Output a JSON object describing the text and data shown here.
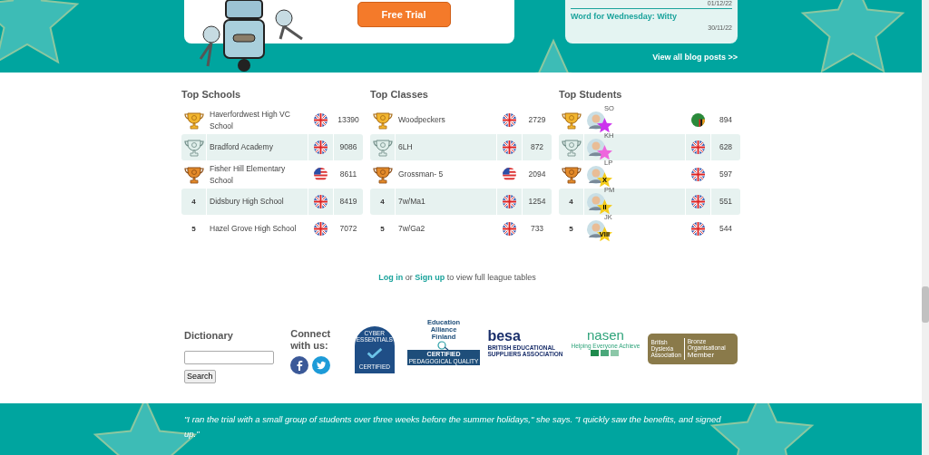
{
  "hero": {
    "button": "Free Trial",
    "blog": {
      "date_top": "01/12/22",
      "post_title": "Word for Wednesday: Witty",
      "post_date": "30/11/22"
    },
    "view_all": "View all blog posts >>"
  },
  "leagues": [
    {
      "title": "Top Schools",
      "rows": [
        {
          "kind": "gold",
          "name": "Haverfordwest High VC School",
          "flag": {
            "kind": "uk"
          },
          "score": "13390",
          "shaded": false
        },
        {
          "kind": "silver",
          "name": "Bradford Academy",
          "flag": {
            "kind": "uk"
          },
          "score": "9086",
          "shaded": true
        },
        {
          "kind": "bronze",
          "name": "Fisher Hill Elementary School",
          "flag": {
            "kind": "us"
          },
          "score": "8611",
          "shaded": false
        },
        {
          "rank": "4",
          "kind": "number",
          "name": "Didsbury High School",
          "flag": {
            "kind": "uk"
          },
          "score": "8419",
          "shaded": true
        },
        {
          "rank": "5",
          "kind": "number",
          "name": "Hazel Grove High School",
          "flag": {
            "kind": "uk"
          },
          "score": "7072",
          "shaded": false
        }
      ]
    },
    {
      "title": "Top Classes",
      "rows": [
        {
          "kind": "gold",
          "name": "Woodpeckers",
          "flag": {
            "kind": "uk"
          },
          "score": "2729",
          "shaded": false
        },
        {
          "kind": "silver",
          "name": "6LH",
          "flag": {
            "kind": "uk"
          },
          "score": "872",
          "shaded": true
        },
        {
          "kind": "bronze",
          "name": "Grossman- 5",
          "flag": {
            "kind": "us"
          },
          "score": "2094",
          "shaded": false
        },
        {
          "rank": "4",
          "kind": "number",
          "name": "7w/Ma1",
          "flag": {
            "kind": "uk"
          },
          "score": "1254",
          "shaded": true
        },
        {
          "rank": "5",
          "kind": "number",
          "name": "7w/Ga2",
          "flag": {
            "kind": "uk"
          },
          "score": "733",
          "shaded": false
        }
      ]
    },
    {
      "title": "Top Students",
      "rows": [
        {
          "kind": "gold",
          "initials": "SO",
          "badge": {
            "color": "#cc33ee"
          },
          "flag": {
            "kind": "zm"
          },
          "score": "894",
          "shaded": false
        },
        {
          "kind": "silver",
          "initials": "KH",
          "badge": {
            "color": "#ee66dd"
          },
          "flag": {
            "kind": "uk"
          },
          "score": "628",
          "shaded": true
        },
        {
          "kind": "bronze",
          "initials": "LP",
          "badge": {
            "color": "#f5cc1a",
            "label": "X"
          },
          "flag": {
            "kind": "uk"
          },
          "score": "597",
          "shaded": false
        },
        {
          "rank": "4",
          "kind": "number",
          "initials": "PM",
          "badge": {
            "color": "#f5cc1a",
            "label": "II"
          },
          "flag": {
            "kind": "uk"
          },
          "score": "551",
          "shaded": true
        },
        {
          "rank": "5",
          "kind": "number",
          "initials": "JK",
          "badge": {
            "color": "#f5cc1a",
            "label": "VIII"
          },
          "flag": {
            "kind": "uk"
          },
          "score": "544",
          "shaded": false
        }
      ]
    }
  ],
  "login_line": {
    "login": "Log in",
    "or": "or",
    "signup": "Sign up",
    "rest": "to view full league tables"
  },
  "dictionary": {
    "title": "Dictionary",
    "button": "Search"
  },
  "connect": {
    "title": "Connect with us:"
  },
  "logos": {
    "cyber": [
      "CYBER ESSENTIALS",
      "CERTIFIED"
    ],
    "eaf": [
      "Education Alliance Finland",
      "CERTIFIED",
      "PEDAGOGICAL QUALITY"
    ],
    "besa": [
      "besa",
      "BRITISH EDUCATIONAL SUPPLIERS ASSOCIATION"
    ],
    "nasen": [
      "nasen",
      "Helping Everyone Achieve"
    ],
    "bda": [
      "British Dyslexia Association",
      "Bronze Organisational",
      "Member"
    ]
  },
  "testimonial": "\"I ran the trial with a small group of students over three weeks before the summer holidays,\" she says. \"I quickly saw the benefits, and signed up.\""
}
